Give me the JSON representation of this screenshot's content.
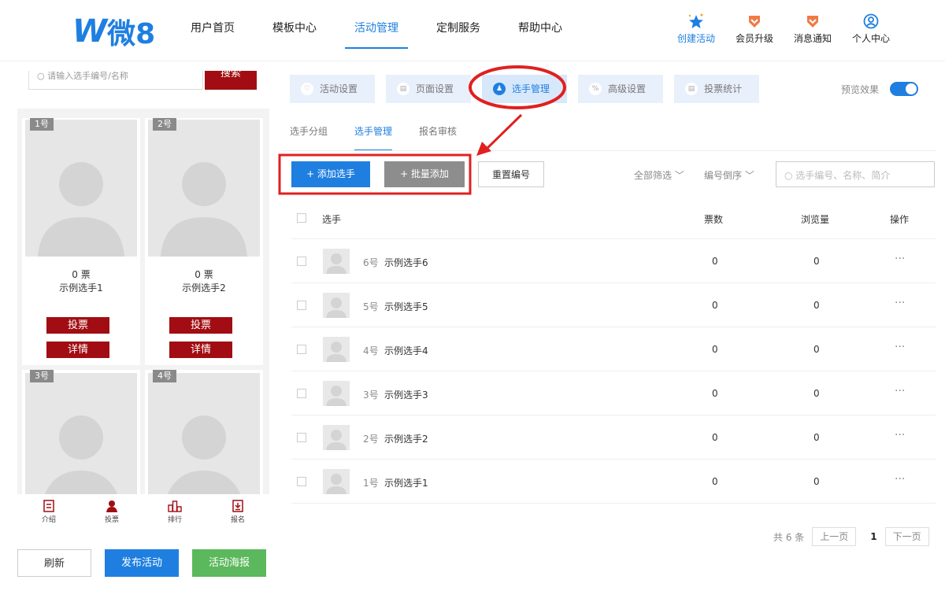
{
  "logo": {
    "brand": "W",
    "text": "微8"
  },
  "nav": {
    "links": [
      "用户首页",
      "模板中心",
      "活动管理",
      "定制服务",
      "帮助中心"
    ],
    "active_index": 2,
    "icons": [
      {
        "label": "创建活动",
        "icon": "star-sparkle-icon"
      },
      {
        "label": "会员升级",
        "icon": "vip-badge-icon"
      },
      {
        "label": "消息通知",
        "icon": "message-badge-icon"
      },
      {
        "label": "个人中心",
        "icon": "user-circle-icon"
      }
    ]
  },
  "preview": {
    "search_placeholder": "请输入选手编号/名称",
    "search_button": "搜索",
    "cards": [
      {
        "num": "1号",
        "votes": "0 票",
        "name": "示例选手1"
      },
      {
        "num": "2号",
        "votes": "0 票",
        "name": "示例选手2"
      },
      {
        "num": "3号",
        "votes": "",
        "name": ""
      },
      {
        "num": "4号",
        "votes": "",
        "name": ""
      }
    ],
    "vote_label": "投票",
    "detail_label": "详情",
    "tabs": [
      "介绍",
      "投票",
      "排行",
      "报名"
    ]
  },
  "actions": {
    "refresh": "刷新",
    "publish": "发布活动",
    "poster": "活动海报"
  },
  "settings": {
    "tabs": [
      "活动设置",
      "页面设置",
      "选手管理",
      "高级设置",
      "投票统计"
    ],
    "active_index": 2,
    "preview_label": "预览效果",
    "preview_on": true
  },
  "subtabs": {
    "items": [
      "选手分组",
      "选手管理",
      "报名审核"
    ],
    "active_index": 1
  },
  "toolbar": {
    "add": "+ 添加选手",
    "batch": "+ 批量添加",
    "reset": "重置编号",
    "filter_all": "全部筛选 ﹀",
    "sort": "编号倒序 ﹀",
    "search_placeholder": "选手编号、名称、简介"
  },
  "table": {
    "headers": {
      "player": "选手",
      "votes": "票数",
      "views": "浏览量",
      "ops": "操作"
    },
    "rows": [
      {
        "num": "6号",
        "name": "示例选手6",
        "votes": "0",
        "views": "0",
        "ops": "···"
      },
      {
        "num": "5号",
        "name": "示例选手5",
        "votes": "0",
        "views": "0",
        "ops": "···"
      },
      {
        "num": "4号",
        "name": "示例选手4",
        "votes": "0",
        "views": "0",
        "ops": "···"
      },
      {
        "num": "3号",
        "name": "示例选手3",
        "votes": "0",
        "views": "0",
        "ops": "···"
      },
      {
        "num": "2号",
        "name": "示例选手2",
        "votes": "0",
        "views": "0",
        "ops": "···"
      },
      {
        "num": "1号",
        "name": "示例选手1",
        "votes": "0",
        "views": "0",
        "ops": "···"
      }
    ]
  },
  "pager": {
    "total": "共 6 条",
    "prev": "上一页",
    "current": "1",
    "next": "下一页"
  },
  "annotations": {
    "color": "#e02020",
    "marks": [
      "circle around the 选手管理 tab",
      "arrow from the circled tab to the buttons",
      "box around the 添加选手 and 批量添加 buttons"
    ]
  },
  "colors": {
    "primary": "#1f7fe0",
    "vote_red": "#a10d12",
    "green": "#5cb85c",
    "annotation_red": "#e02020"
  }
}
